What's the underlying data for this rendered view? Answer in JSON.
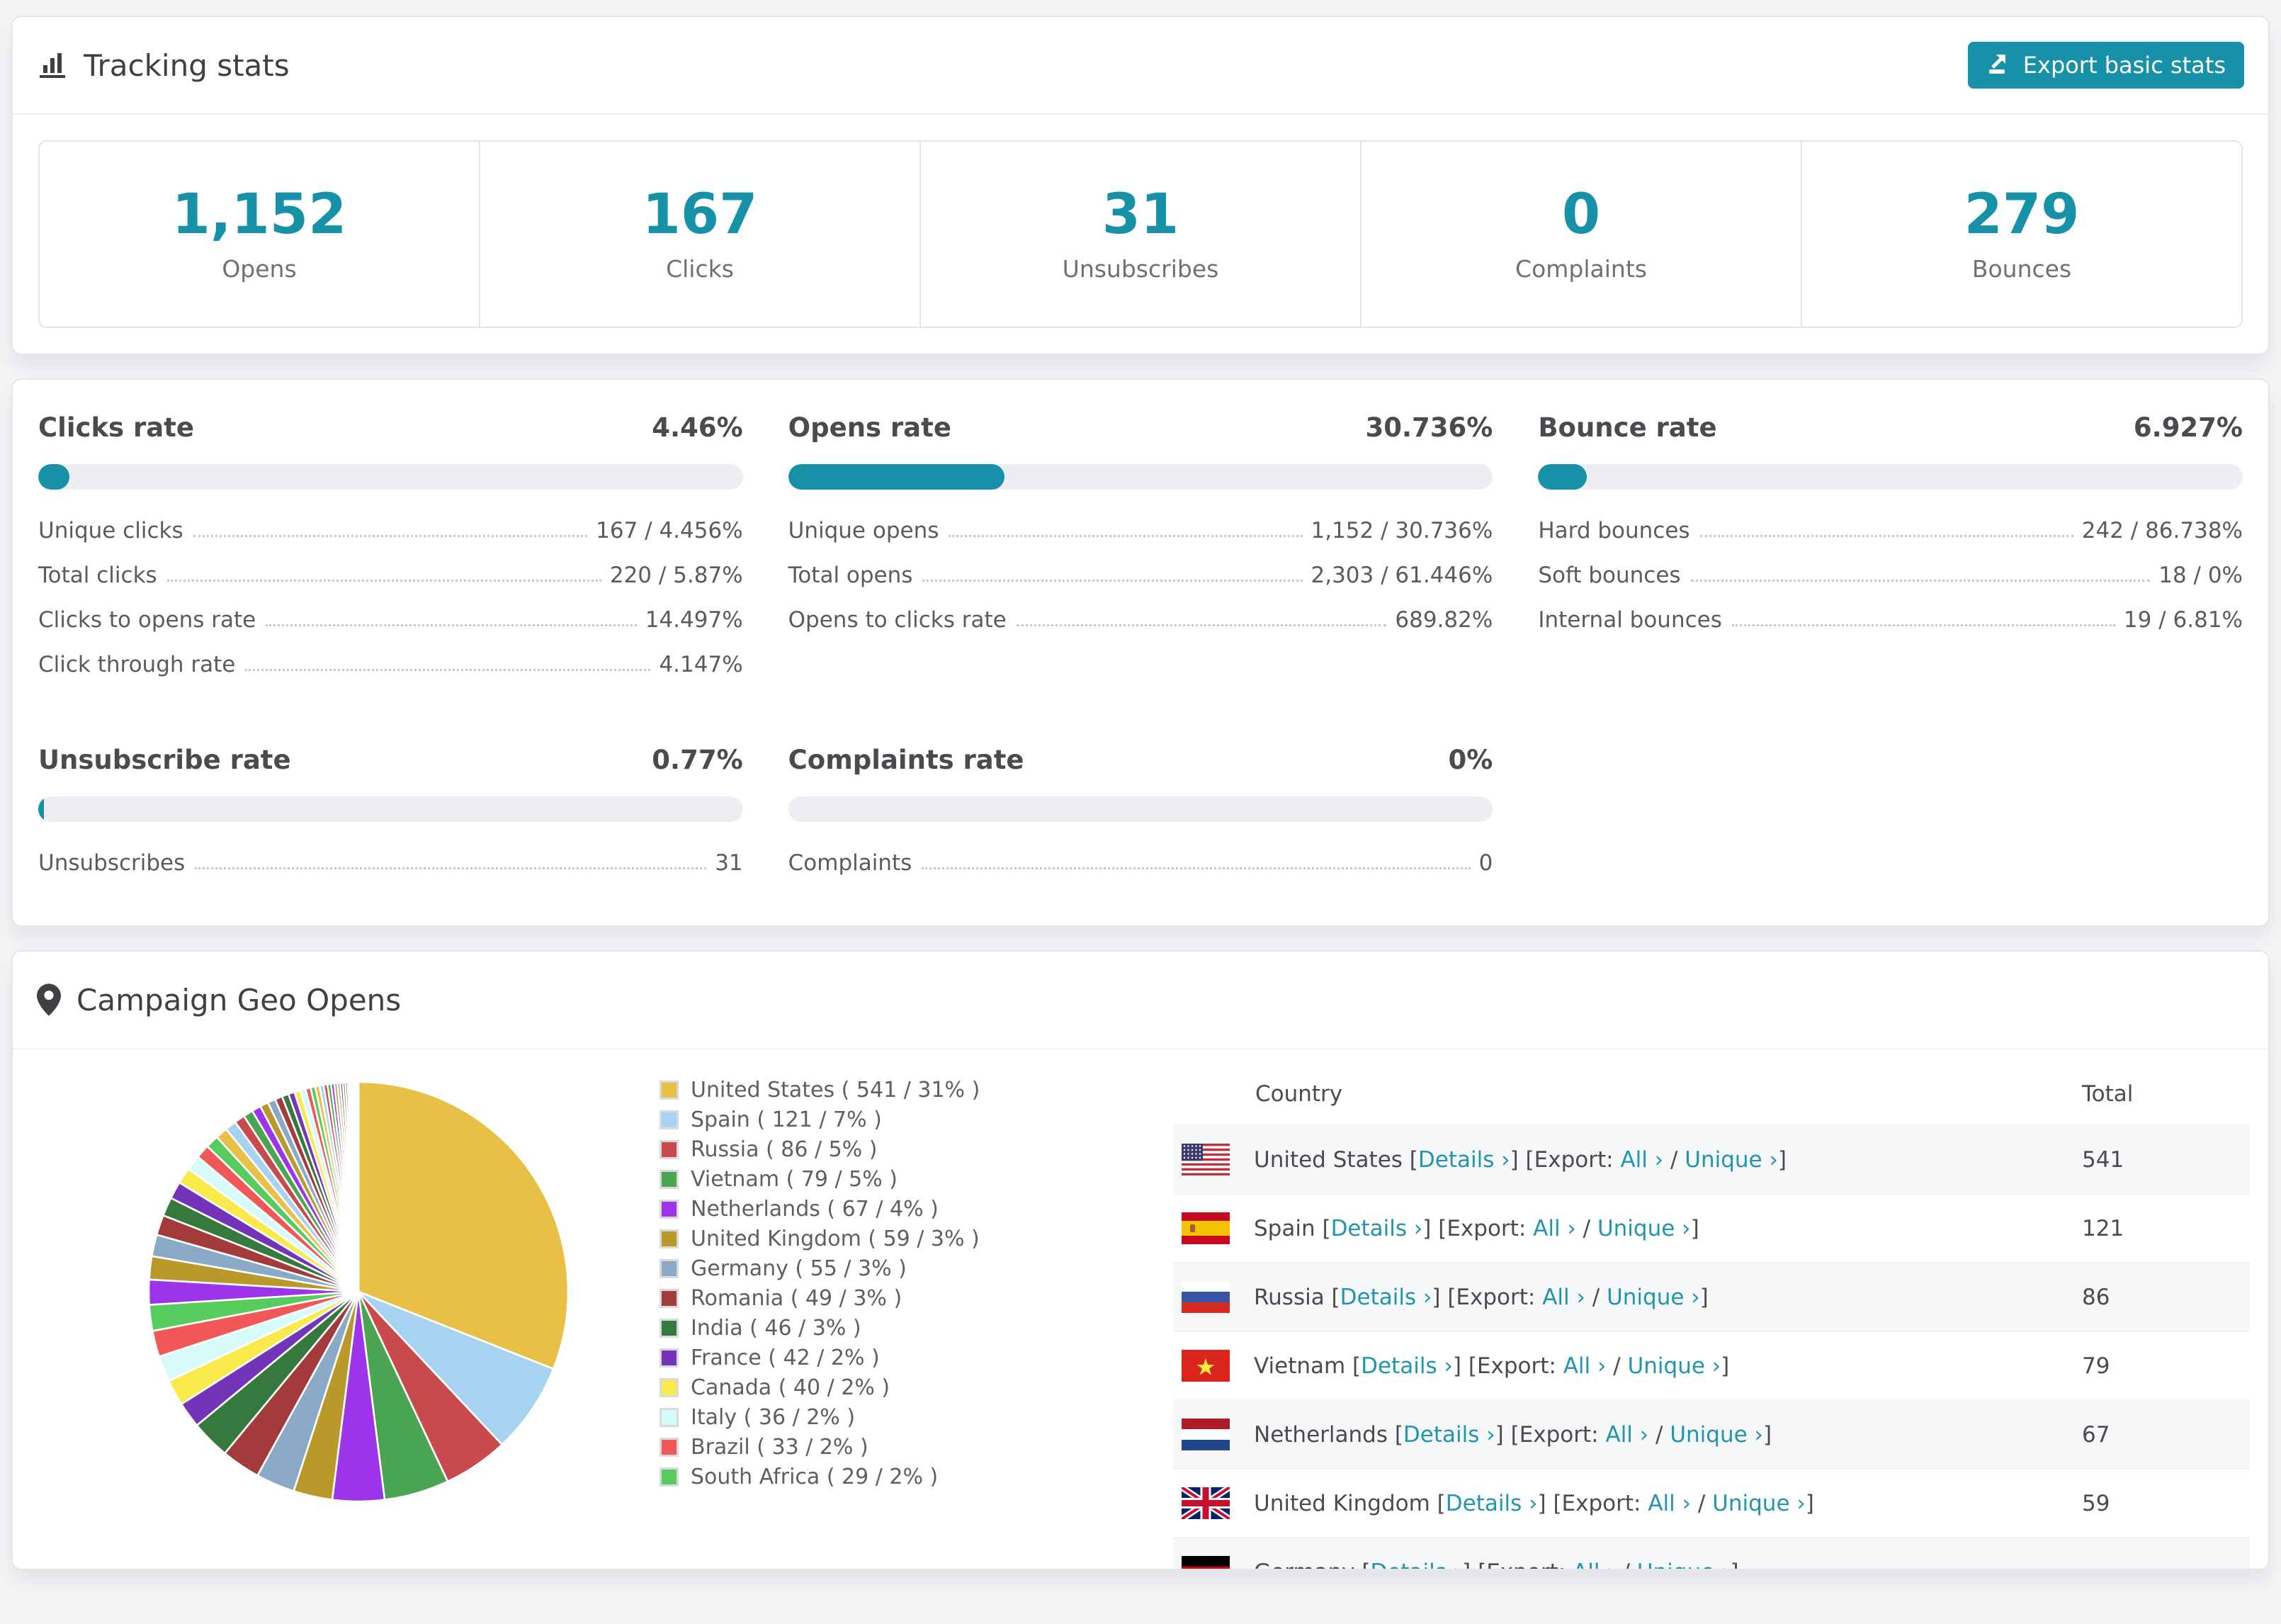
{
  "colors": {
    "accent": "#1791a8",
    "link": "#2095ad",
    "bar_track": "#edeef1",
    "card_border": "#e5e6e9",
    "stripe_row": "#f6f7f9",
    "text_dark": "#3e4043",
    "text_muted": "#6f7074"
  },
  "tracking": {
    "title": "Tracking stats",
    "export_label": "Export basic stats",
    "stats": [
      {
        "value": "1,152",
        "label": "Opens"
      },
      {
        "value": "167",
        "label": "Clicks"
      },
      {
        "value": "31",
        "label": "Unsubscribes"
      },
      {
        "value": "0",
        "label": "Complaints"
      },
      {
        "value": "279",
        "label": "Bounces"
      }
    ]
  },
  "rates": {
    "sections": [
      {
        "title": "Clicks rate",
        "value": "4.46%",
        "percent": 4.46,
        "rows": [
          [
            "Unique clicks",
            "167 / 4.456%"
          ],
          [
            "Total clicks",
            "220 / 5.87%"
          ],
          [
            "Clicks to opens rate",
            "14.497%"
          ],
          [
            "Click through rate",
            "4.147%"
          ]
        ]
      },
      {
        "title": "Opens rate",
        "value": "30.736%",
        "percent": 30.736,
        "rows": [
          [
            "Unique opens",
            "1,152 / 30.736%"
          ],
          [
            "Total opens",
            "2,303 / 61.446%"
          ],
          [
            "Opens to clicks rate",
            "689.82%"
          ]
        ]
      },
      {
        "title": "Bounce rate",
        "value": "6.927%",
        "percent": 6.927,
        "rows": [
          [
            "Hard bounces",
            "242 / 86.738%"
          ],
          [
            "Soft bounces",
            "18 / 0%"
          ],
          [
            "Internal bounces",
            "19 / 6.81%"
          ]
        ]
      },
      {
        "title": "Unsubscribe rate",
        "value": "0.77%",
        "percent": 0.77,
        "rows": [
          [
            "Unsubscribes",
            "31"
          ]
        ]
      },
      {
        "title": "Complaints rate",
        "value": "0%",
        "percent": 0,
        "rows": [
          [
            "Complaints",
            "0"
          ]
        ]
      }
    ]
  },
  "geo": {
    "title": "Campaign Geo Opens",
    "chart_data": {
      "type": "pie",
      "labels": [
        "United States",
        "Spain",
        "Russia",
        "Vietnam",
        "Netherlands",
        "United Kingdom",
        "Germany",
        "Romania",
        "India",
        "France",
        "Canada",
        "Italy",
        "Brazil",
        "South Africa"
      ],
      "values": [
        541,
        121,
        86,
        79,
        67,
        59,
        55,
        49,
        46,
        42,
        40,
        36,
        33,
        29
      ],
      "percents": [
        31,
        7,
        5,
        5,
        4,
        3,
        3,
        3,
        3,
        2,
        2,
        2,
        2,
        2
      ],
      "colors": [
        "#e9c046",
        "#a8d3f0",
        "#c94a4d",
        "#4aa552",
        "#9c35ea",
        "#b9992a",
        "#8aa9c7",
        "#a43b3b",
        "#35793f",
        "#7434ba",
        "#fae94a",
        "#d7fbfa",
        "#f25757",
        "#58cb5e"
      ],
      "unlabeled_remainder_percent": 26,
      "start_angle_deg": 0,
      "direction": "clockwise",
      "legend_position": "right"
    },
    "table": {
      "headers": [
        "Country",
        "Total"
      ],
      "links": {
        "details": "Details ›",
        "export_prefix": "Export:",
        "all": "All ›",
        "unique": "Unique ›"
      },
      "rows": [
        {
          "country": "United States",
          "flag": "us",
          "total": "541"
        },
        {
          "country": "Spain",
          "flag": "es",
          "total": "121"
        },
        {
          "country": "Russia",
          "flag": "ru",
          "total": "86"
        },
        {
          "country": "Vietnam",
          "flag": "vn",
          "total": "79"
        },
        {
          "country": "Netherlands",
          "flag": "nl",
          "total": "67"
        },
        {
          "country": "United Kingdom",
          "flag": "gb",
          "total": "59"
        },
        {
          "country": "Germany",
          "flag": "de",
          "total": "",
          "partial": true
        }
      ]
    }
  }
}
